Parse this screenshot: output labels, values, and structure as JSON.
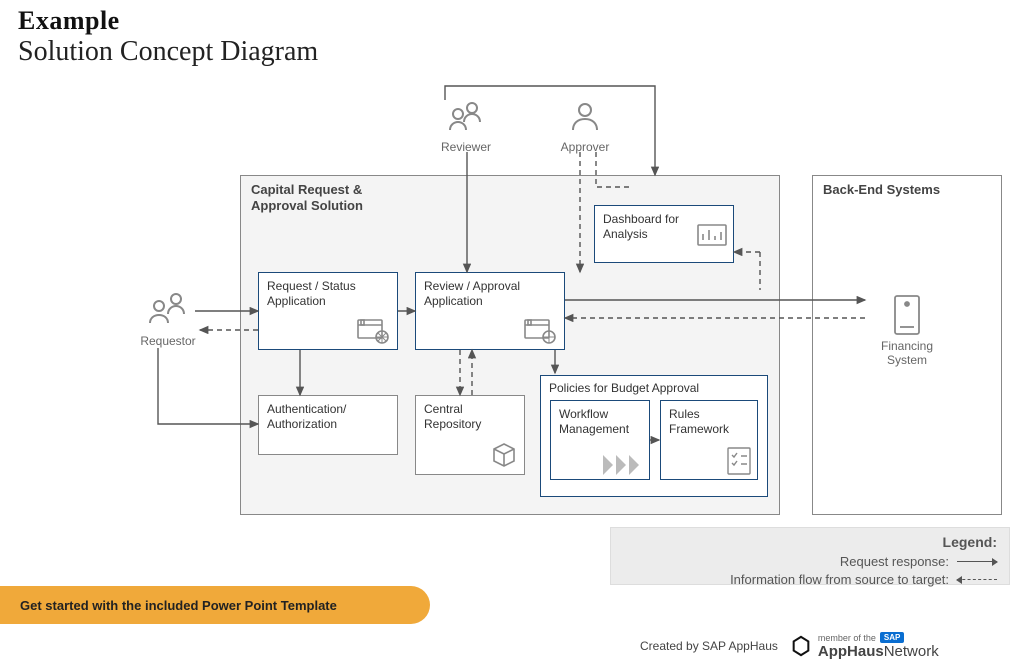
{
  "header": {
    "example": "Example",
    "title": "Solution Concept Diagram"
  },
  "actors": {
    "requestor": "Requestor",
    "reviewer": "Reviewer",
    "approver": "Approver"
  },
  "containers": {
    "solution": "Capital Request & Approval Solution",
    "backend": "Back-End Systems"
  },
  "cards": {
    "request_status": "Request / Status Application",
    "review_approval": "Review / Approval Application",
    "dashboard": "Dashboard for Analysis",
    "auth": "Authentication/ Authorization",
    "central_repo": "Central Repository",
    "policies_group": "Policies for Budget Approval",
    "workflow": "Workflow Management",
    "rules": "Rules Framework",
    "financing": "Financing System"
  },
  "legend": {
    "title": "Legend:",
    "request_response": "Request response:",
    "info_flow": "Information flow from source to target:"
  },
  "cta": "Get started with the included Power Point Template",
  "footer": {
    "created_by": "Created by SAP AppHaus",
    "member_of": "member of the",
    "sap": "SAP",
    "brand_bold": "AppHaus",
    "brand_light": "Network"
  }
}
